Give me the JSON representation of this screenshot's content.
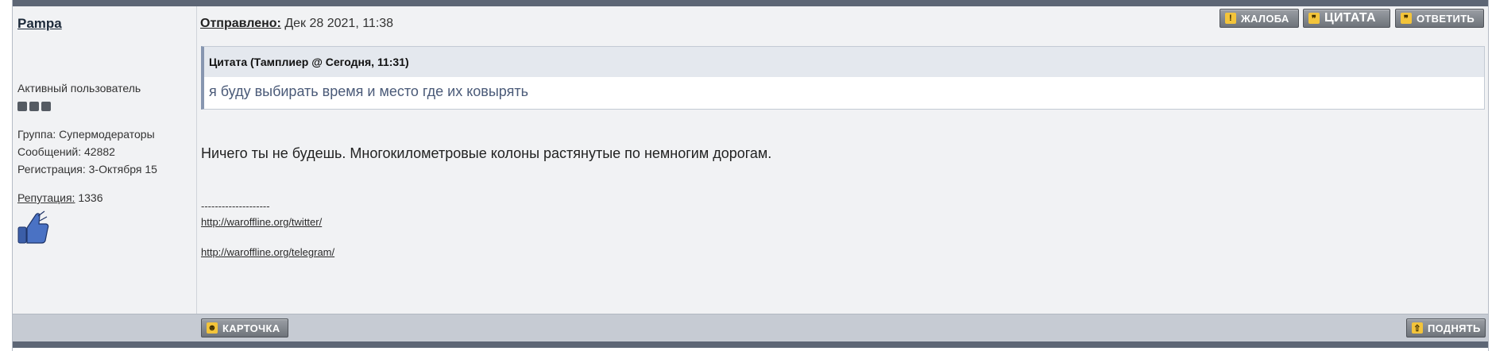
{
  "author": {
    "name": "Pampa",
    "rank": "Активный пользователь",
    "group": "Группа: Супермодераторы",
    "posts": "Сообщений: 42882",
    "registered": "Регистрация: 3-Октября 15",
    "reputation_label": "Репутация:",
    "reputation_value": "1336",
    "rank_dots": 3
  },
  "header": {
    "sent_label": "Отправлено:",
    "sent_date": "Дек 28 2021, 11:38",
    "buttons": {
      "report": "ЖАЛОБА",
      "quote": "ЦИТАТА",
      "reply": "ОТВЕТИТЬ"
    }
  },
  "quote": {
    "header": "Цитата (Тамплиер @ Сегодня, 11:31)",
    "text": "я буду выбирать время и место где их ковырять"
  },
  "message": {
    "text": "Ничего ты не будешь. Многокилометровые колоны растянутые по немногим дорогам."
  },
  "signature": {
    "separator": "--------------------",
    "link1": "http://waroffline.org/twitter/",
    "link2": "http://waroffline.org/telegram/"
  },
  "footer": {
    "profile_button": "КАРТОЧКА",
    "up_button": "ПОДНЯТЬ"
  },
  "colors": {
    "bar": "#5d6675",
    "panel": "#f1f2f4",
    "footer": "#c6cbd3",
    "button": "#7b8087",
    "icon": "#f3c43a"
  }
}
